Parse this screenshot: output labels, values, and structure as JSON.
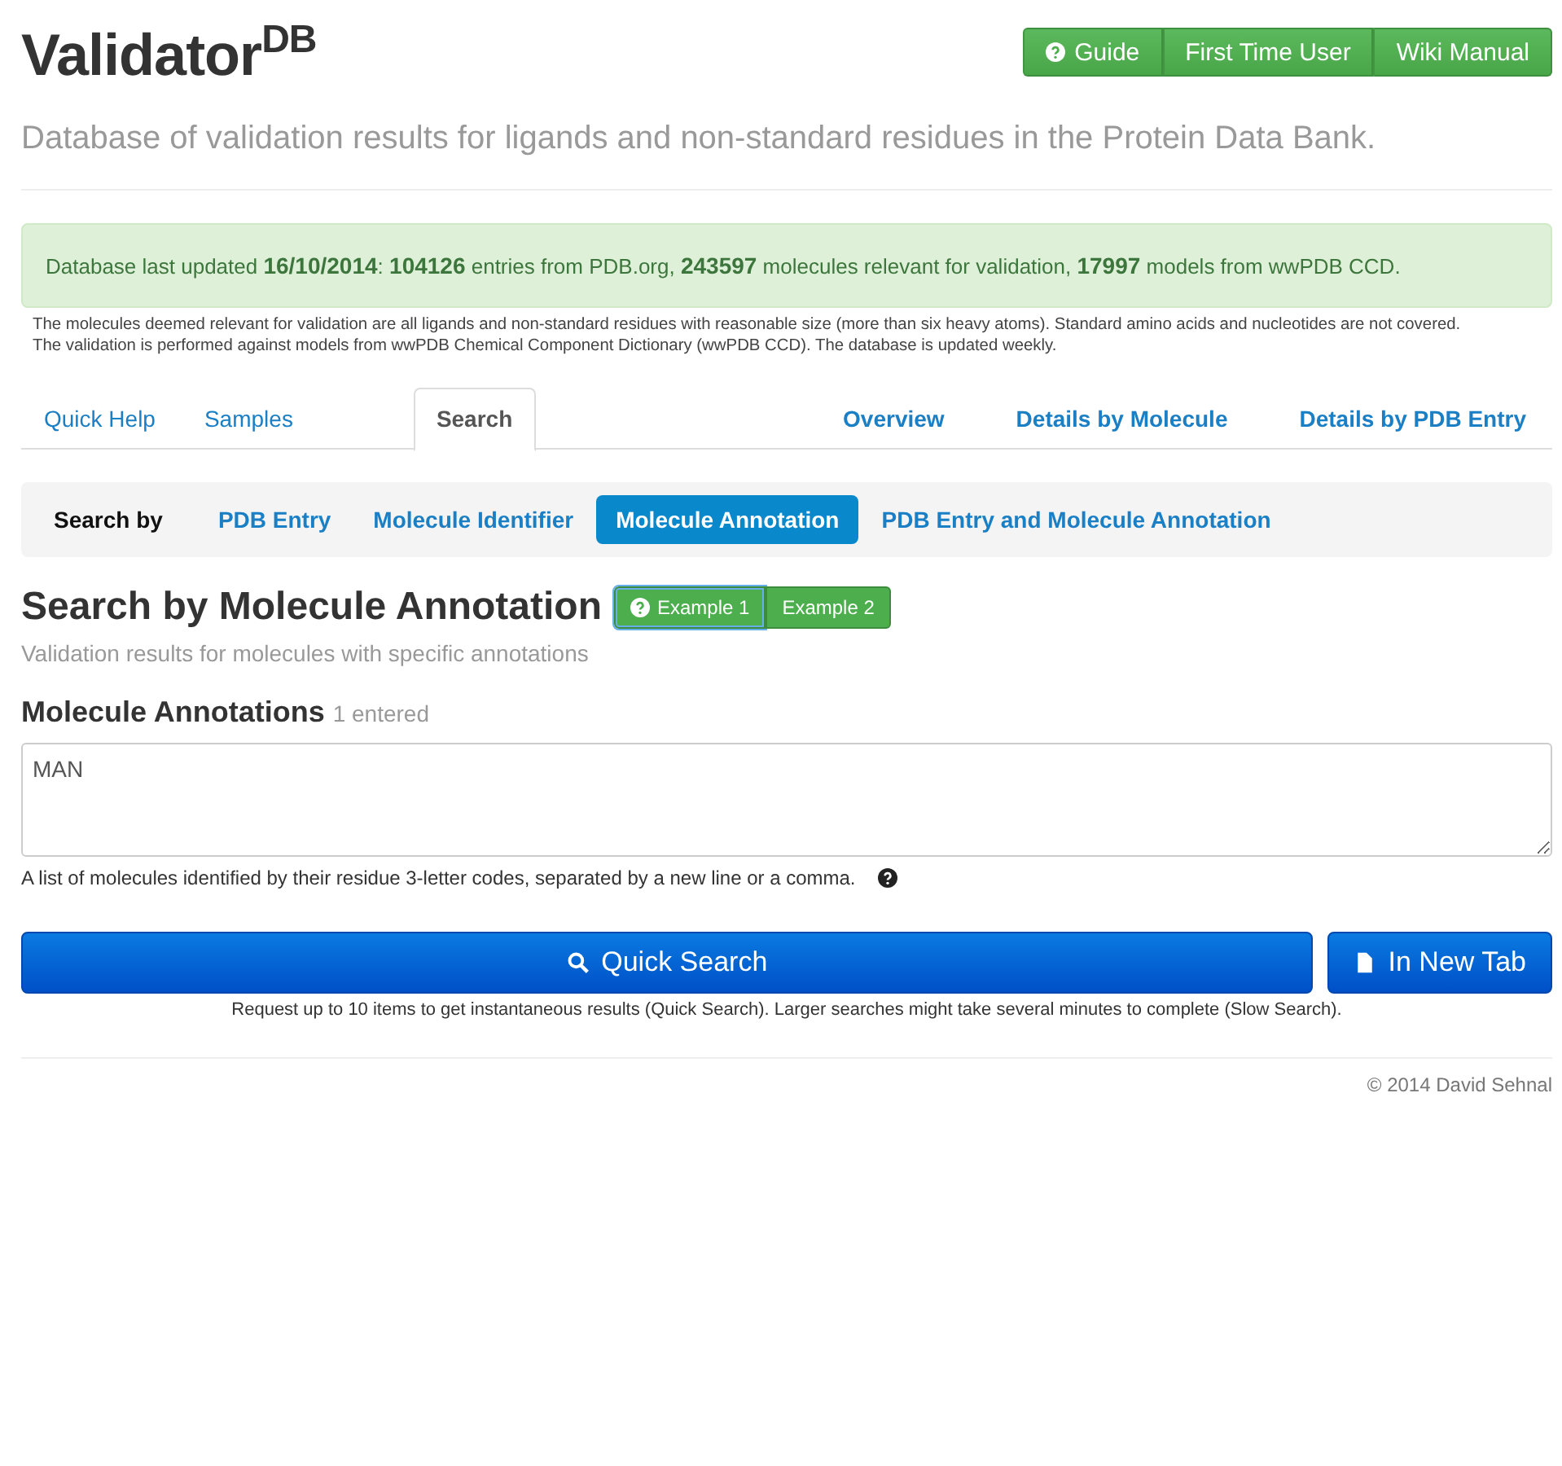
{
  "header": {
    "title": "Validator$^{DB}$",
    "subtitle": "Database of validation results for ligands and non-standard residues in the Protein Data Bank.",
    "buttons": [
      {
        "label": "Guide"
      },
      {
        "label": "First Time User"
      },
      {
        "label": "Wiki Manual"
      }
    ]
  },
  "alert": {
    "text": "Database last updated **16/10/2014**: **104126** entries from PDB.org, **243597** molecules relevant for validation, **17997** models from wwPDB CCD."
  },
  "notes": [
    "The molecules deemed relevant for validation are all ligands and non-standard residues with reasonable size (more than six heavy atoms). Standard amino acids and nucleotides are not covered.",
    "The validation is performed against models from wwPDB Chemical Component Dictionary (wwPDB CCD). The database is updated weekly."
  ],
  "tabs_left": [
    {
      "label": "Quick Help",
      "selected": false
    },
    {
      "label": "Samples",
      "selected": false
    },
    {
      "label": "Search",
      "selected": true
    }
  ],
  "tabs_right": [
    {
      "label": "Overview",
      "selected": false
    },
    {
      "label": "Details by Molecule",
      "selected": false
    },
    {
      "label": "Details by PDB Entry",
      "selected": false
    }
  ],
  "search_by": {
    "label": "Search by",
    "pills": [
      {
        "label": "PDB Entry",
        "selected": false
      },
      {
        "label": "Molecule Identifier",
        "selected": false
      },
      {
        "label": "Molecule Annotation",
        "selected": true
      },
      {
        "label": "PDB Entry and Molecule Annotation",
        "selected": false
      }
    ]
  },
  "section": {
    "title": "Search by Molecule Annotation",
    "examples": [
      {
        "label": "Example 1",
        "focused": true
      },
      {
        "label": "Example 2",
        "focused": false
      }
    ],
    "subtitle": "Validation results for molecules with specific annotations"
  },
  "field": {
    "label": "Molecule Annotations",
    "count": "1 entered",
    "value": "MAN",
    "help": "A list of molecules identified by their residue 3-letter codes, separated by a new line or a comma."
  },
  "actions": [
    {
      "label": "Quick Search"
    },
    {
      "label": "In New Tab"
    }
  ],
  "action_note": "Request up to 10 items to get instantaneous results (Quick Search). Larger searches might take several minutes to complete (Slow Search).",
  "footer": "© 2014 David Sehnal"
}
